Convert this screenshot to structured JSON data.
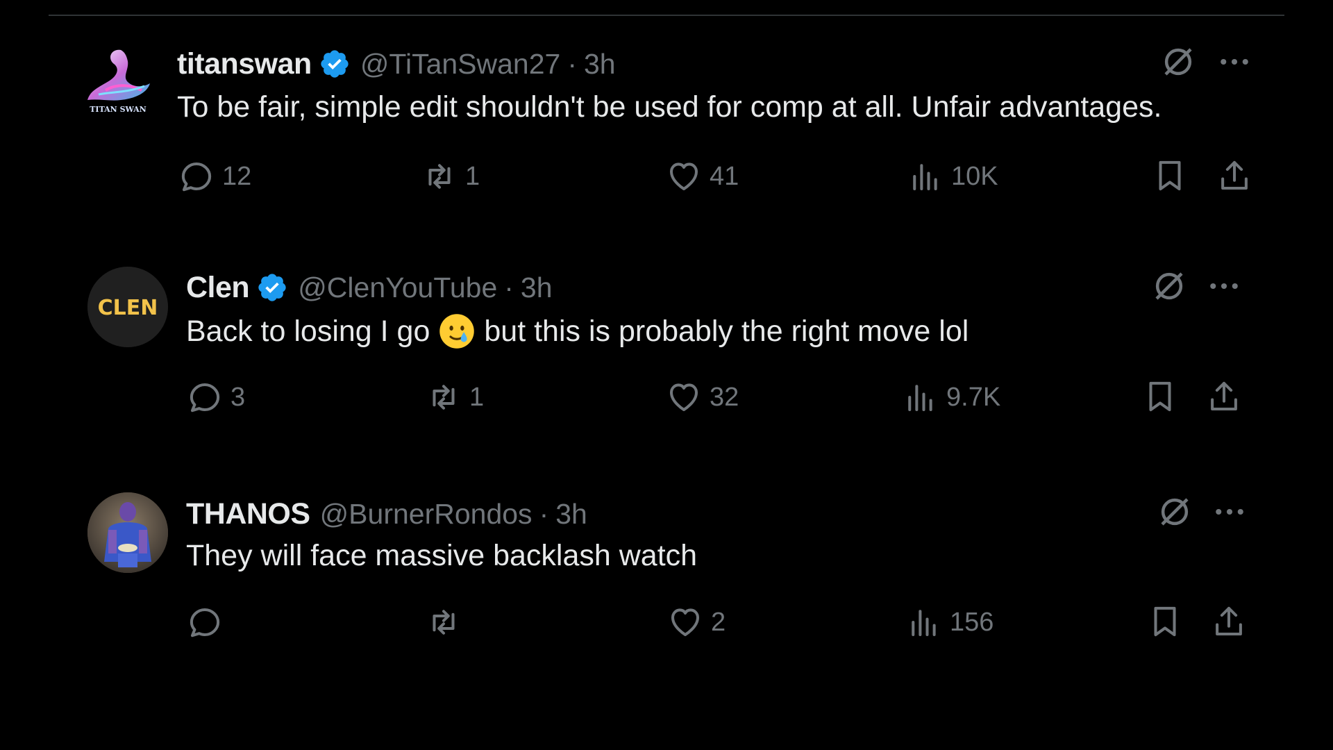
{
  "colors": {
    "background": "#000000",
    "text_primary": "#e7e9ea",
    "text_secondary": "#71767b",
    "verified_blue": "#1d9bf0"
  },
  "tweets": [
    {
      "name": "titanswan",
      "verified": true,
      "handle": "@TiTanSwan27",
      "separator": "·",
      "time": "3h",
      "text": "To be fair, simple edit shouldn't be used for comp at all. Unfair advantages.",
      "avatar_logo_text": "TITAN SWAN",
      "replies": "12",
      "reposts": "1",
      "likes": "41",
      "views": "10K",
      "icons": [
        "grok-icon",
        "more-icon",
        "reply-icon",
        "repost-icon",
        "like-icon",
        "views-icon",
        "bookmark-icon",
        "share-icon"
      ]
    },
    {
      "name": "Clen",
      "verified": true,
      "handle": "@ClenYouTube",
      "separator": "·",
      "time": "3h",
      "text_before": "Back to losing I go",
      "emoji": "smiling-face-with-tear-emoji",
      "text_after": "but this is probably the right move lol",
      "avatar_logo_text": "CLEN",
      "replies": "3",
      "reposts": "1",
      "likes": "32",
      "views": "9.7K"
    },
    {
      "name": "THANOS",
      "verified": false,
      "handle": "@BurnerRondos",
      "separator": "·",
      "time": "3h",
      "text": "They will face massive backlash watch",
      "replies": "",
      "reposts": "",
      "likes": "2",
      "views": "156"
    }
  ]
}
